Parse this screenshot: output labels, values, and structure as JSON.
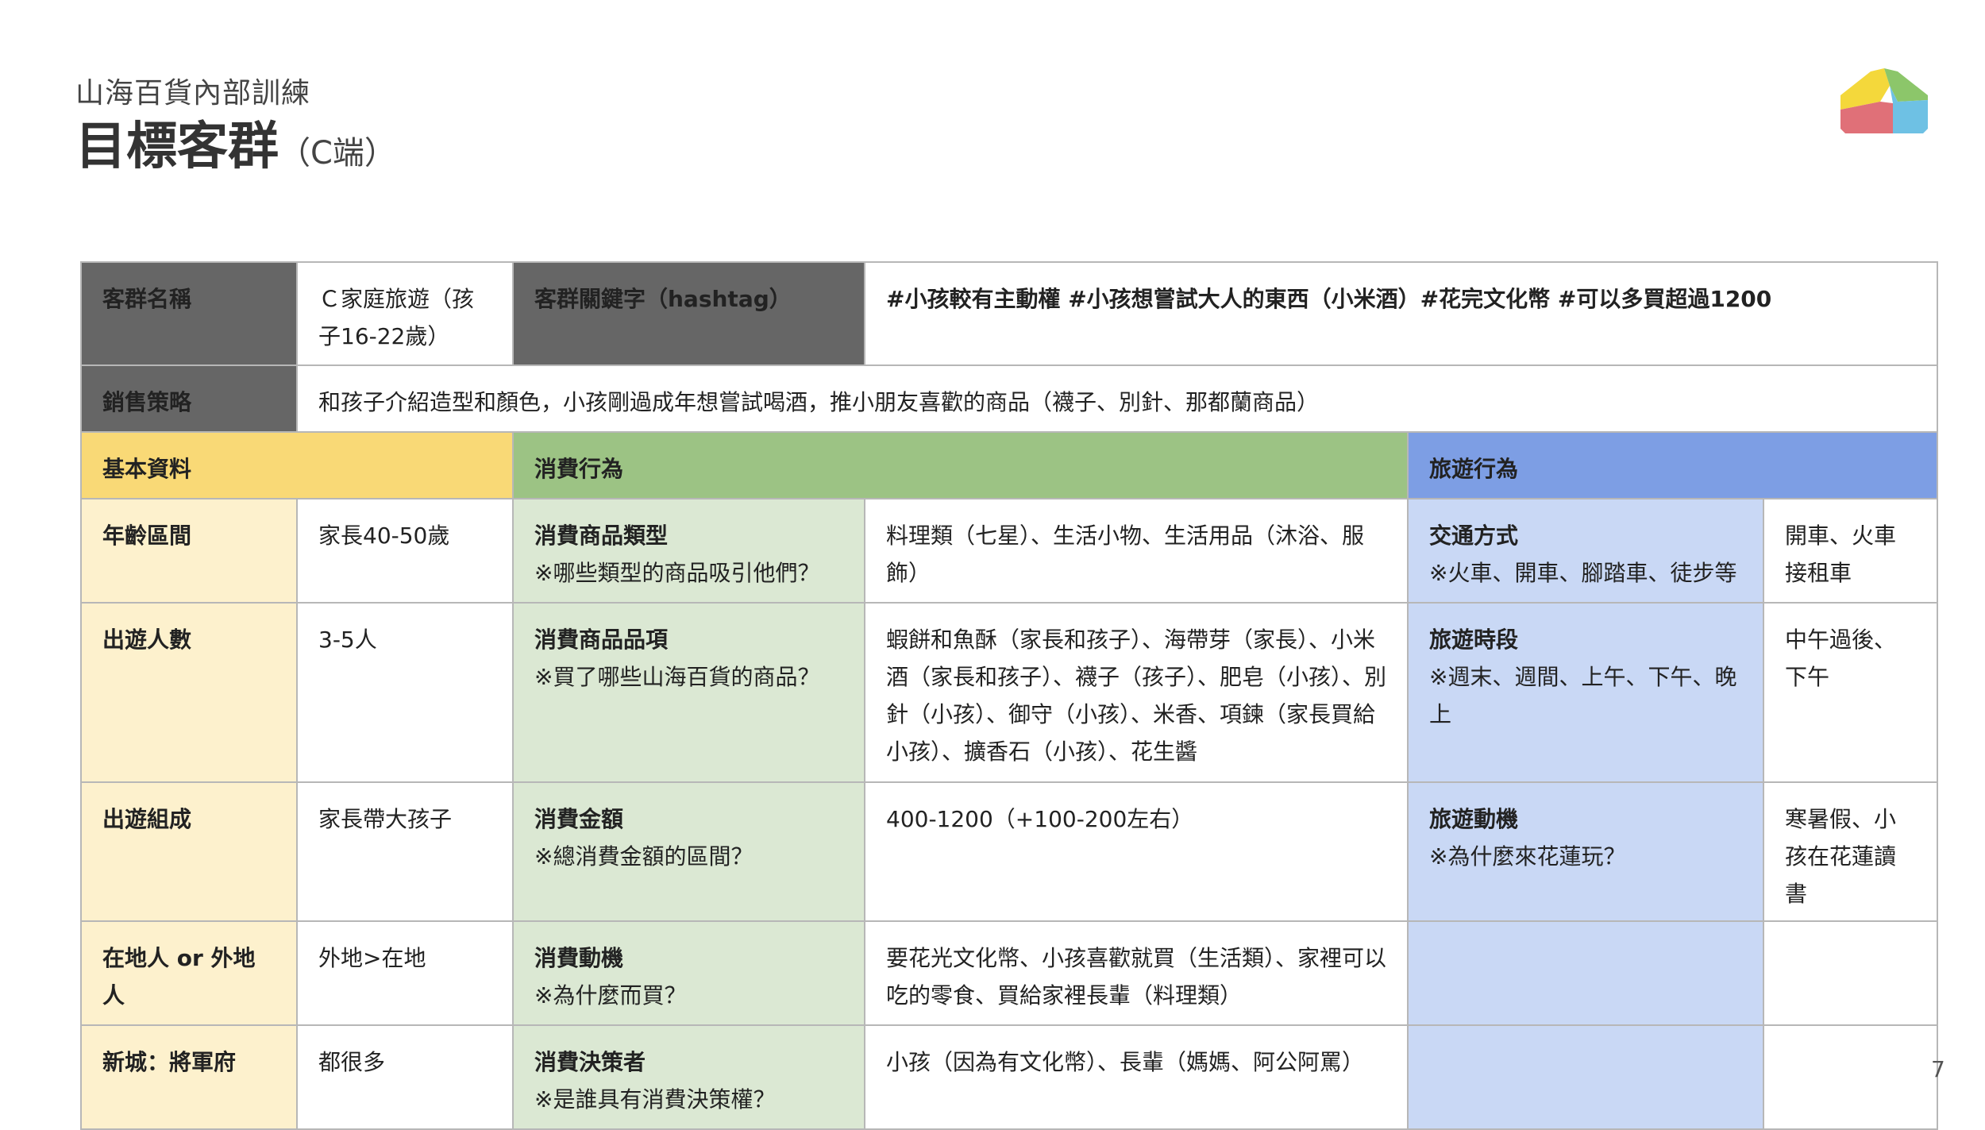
{
  "header": {
    "subtitle": "山海百貨內部訓練",
    "title": "目標客群",
    "title_suffix": "（C端）"
  },
  "page_number": "7",
  "table": {
    "group_name_label": "客群名稱",
    "group_name_value": "Ｃ家庭旅遊（孩子16-22歲）",
    "hashtag_label": "客群關鍵字（hashtag）",
    "hashtag_value": "#小孩較有主動權 #小孩想嘗試大人的東西（小米酒）#花完文化幣 #可以多買超過1200",
    "strategy_label": "銷售策略",
    "strategy_value": "和孩子介紹造型和顏色，小孩剛過成年想嘗試喝酒，推小朋友喜歡的商品（襪子、別針、那都蘭商品）",
    "section_basic": "基本資料",
    "section_consume": "消費行為",
    "section_travel": "旅遊行為",
    "rows": [
      {
        "basic_label": "年齡區間",
        "basic_value": "家長40-50歲",
        "consume_label": "消費商品類型",
        "consume_note": "※哪些類型的商品吸引他們？",
        "consume_value": "料理類（七星）、生活小物、生活用品（沐浴、服飾）",
        "travel_label": "交通方式",
        "travel_note": "※火車、開車、腳踏車、徒步等",
        "travel_value": "開車、火車接租車"
      },
      {
        "basic_label": "出遊人數",
        "basic_value": "3-5人",
        "consume_label": "消費商品品項",
        "consume_note": "※買了哪些山海百貨的商品？",
        "consume_value": "蝦餅和魚酥（家長和孩子）、海帶芽（家長）、小米酒（家長和孩子）、襪子（孩子）、肥皂（小孩）、別針（小孩）、御守（小孩）、米香、項鍊（家長買給小孩）、擴香石（小孩）、花生醬",
        "travel_label": "旅遊時段",
        "travel_note": "※週末、週間、上午、下午、晚上",
        "travel_value": "中午過後、下午"
      },
      {
        "basic_label": "出遊組成",
        "basic_value": "家長帶大孩子",
        "consume_label": "消費金額",
        "consume_note": "※總消費金額的區間？",
        "consume_value": "400-1200（+100-200左右）",
        "travel_label": "旅遊動機",
        "travel_note": "※為什麼來花蓮玩？",
        "travel_value": "寒暑假、小孩在花蓮讀書"
      },
      {
        "basic_label": "在地人 or 外地人",
        "basic_value": "外地>在地",
        "consume_label": "消費動機",
        "consume_note": "※為什麼而買？",
        "consume_value": "要花光文化幣、小孩喜歡就買（生活類）、家裡可以吃的零食、買給家裡長輩（料理類）",
        "travel_label": "",
        "travel_note": "",
        "travel_value": ""
      },
      {
        "basic_label": "新城：將軍府",
        "basic_value": "都很多",
        "consume_label": "消費決策者",
        "consume_note": "※是誰具有消費決策權？",
        "consume_value": "小孩（因為有文化幣）、長輩（媽媽、阿公阿罵）",
        "travel_label": "",
        "travel_note": "",
        "travel_value": ""
      }
    ]
  },
  "colors": {
    "dark_header": "#666666",
    "basic_header": "#f9d976",
    "basic_cell": "#fdf1cd",
    "consume_header": "#9cc384",
    "consume_cell": "#dbe8d3",
    "travel_header": "#7d9ee4",
    "travel_cell": "#c9d8f5"
  },
  "logo": {
    "icon": "house-logo-icon",
    "colors": [
      "#f4d83b",
      "#8cc66a",
      "#6ec1e4",
      "#e07078"
    ]
  }
}
